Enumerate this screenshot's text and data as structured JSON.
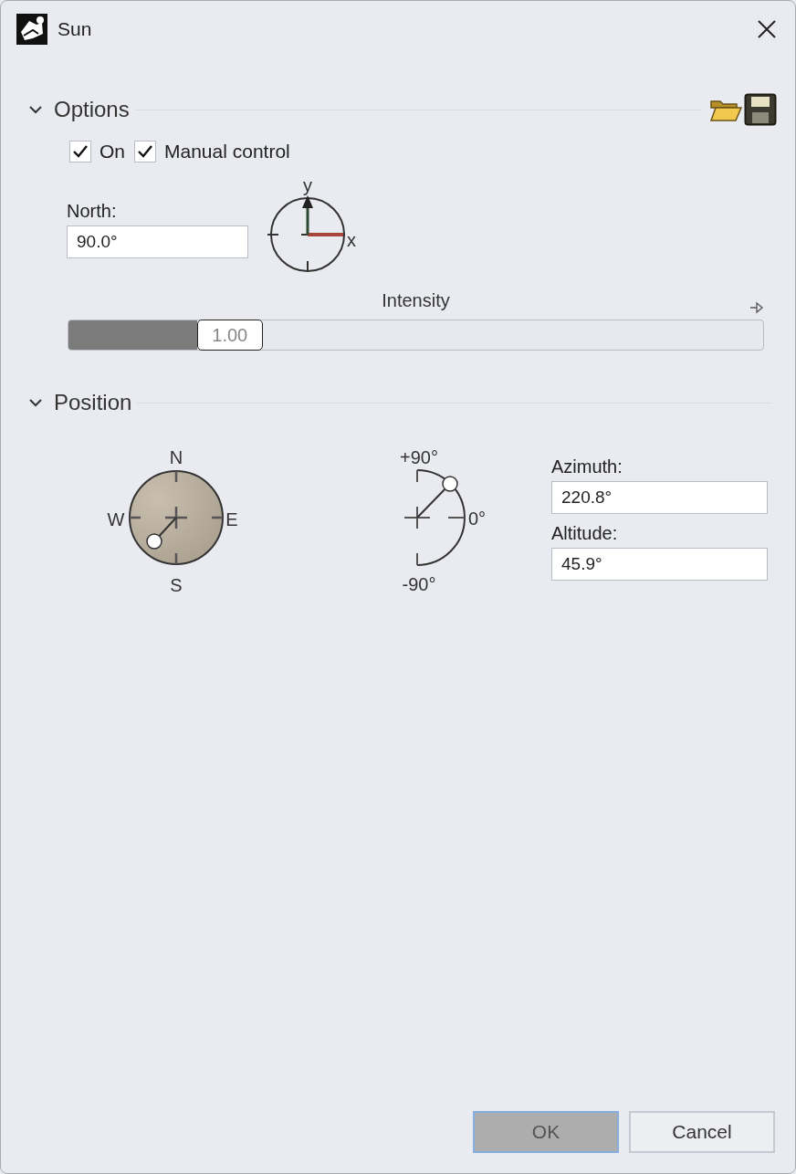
{
  "window": {
    "title": "Sun"
  },
  "options": {
    "title": "Options",
    "expanded": true,
    "checkboxes": [
      {
        "label": "On",
        "checked": true
      },
      {
        "label": "Manual control",
        "checked": true
      }
    ],
    "north": {
      "label": "North:",
      "value": "90.0°"
    },
    "axes": {
      "x_label": "x",
      "y_label": "y"
    },
    "intensity": {
      "label": "Intensity",
      "value": "1.00",
      "level": 0.185
    }
  },
  "position": {
    "title": "Position",
    "expanded": true,
    "compass": {
      "north": "N",
      "west": "W",
      "east": "E",
      "south": "S"
    },
    "altitude_dial": {
      "top": "+90°",
      "zero": "0°",
      "bottom": "-90°"
    },
    "azimuth": {
      "label": "Azimuth:",
      "value": "220.8°"
    },
    "altitude": {
      "label": "Altitude:",
      "value": "45.9°"
    }
  },
  "buttons": [
    {
      "label": "OK",
      "default": true
    },
    {
      "label": "Cancel",
      "default": false
    }
  ]
}
